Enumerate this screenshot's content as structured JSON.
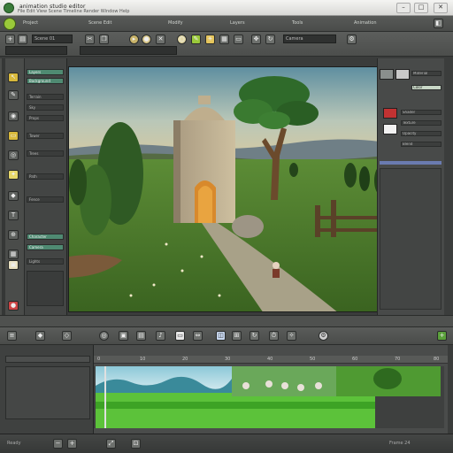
{
  "window": {
    "title": "animation studio editor",
    "menu": "File  Edit  View  Scene  Timeline  Render  Window  Help",
    "minimize_glyph": "–",
    "maximize_glyph": "□",
    "close_glyph": "✕"
  },
  "toolbar1": {
    "items": [
      "Project",
      "Scene Edit",
      "Modify",
      "Layers",
      "Tools",
      "Animation"
    ]
  },
  "toolbar2": {
    "field_left": "Scene 01",
    "field_right": "Camera"
  },
  "left_panel": {
    "rows": [
      "Layers",
      "Background",
      "Terrain",
      "Sky",
      "Props",
      "Tower",
      "Trees",
      "Path",
      "Fence",
      "Character",
      "Camera",
      "Lights"
    ]
  },
  "right_panel": {
    "rows": [
      "Material",
      "Color",
      "Shader",
      "Texture",
      "Opacity",
      "Blend"
    ]
  },
  "timeline": {
    "ruler_marks": [
      "0",
      "10",
      "20",
      "30",
      "40",
      "50",
      "60",
      "70",
      "80"
    ]
  },
  "status": {
    "left": "Ready",
    "right": "Frame 24"
  },
  "colors": {
    "accent": "#4f8a72",
    "sky_top": "#5f8fa0",
    "grass": "#4d7a2c"
  }
}
